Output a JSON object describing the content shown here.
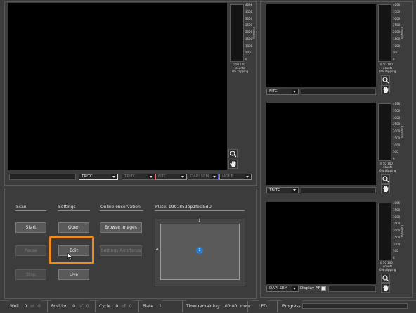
{
  "histogram": {
    "ticks": [
      "4096",
      "3500",
      "3000",
      "2500",
      "2000",
      "1500",
      "1000",
      "500",
      "0"
    ],
    "x_ticks": "0   50  100",
    "counts_label": "counts",
    "intensity_label": "Intensity",
    "clipping": "0% clipping"
  },
  "main_view": {
    "channels": [
      "TRITC",
      "TRITC",
      "FITC",
      "DAPI SEM",
      "NONE"
    ],
    "channel_colors": [
      "#dcdcdc",
      "#c83c3c",
      "#3cc83c",
      "#5a5ad2",
      "#8a8a8a"
    ]
  },
  "side_views": [
    {
      "channel": "FITC"
    },
    {
      "channel": "TRITC"
    },
    {
      "channel": "DAPI SEM",
      "display_af_label": "Display AF"
    }
  ],
  "sections": {
    "scan": "Scan",
    "settings": "Settings",
    "online_observation": "Online observation",
    "plate": "Plate: 1991853bp1fociEdU"
  },
  "buttons": {
    "start": "Start",
    "pause": "Pause",
    "stop": "Stop",
    "open": "Open",
    "edit": "Edit",
    "live": "Live",
    "browse_images": "Browse Images",
    "settings_autofocus": "Settings Autofocus"
  },
  "plate_map": {
    "column_label": "1",
    "row_label": "A",
    "well_label": "1",
    "well_color": "#2a7fd4"
  },
  "status": {
    "well_label": "Well",
    "well_value": "0",
    "well_of": "of",
    "well_total": "0",
    "position_label": "Position",
    "position_value": "0",
    "position_of": "of",
    "position_total": "0",
    "cycle_label": "Cycle",
    "cycle_value": "0",
    "cycle_of": "of",
    "cycle_total": "0",
    "plate_label": "Plate",
    "plate_value": "1",
    "time_label": "Time remaining:",
    "time_value": "00:00",
    "time_unit": "h:min",
    "led_label": "LED",
    "progress_label": "Progress:"
  },
  "highlight_color": "#f08c1e"
}
